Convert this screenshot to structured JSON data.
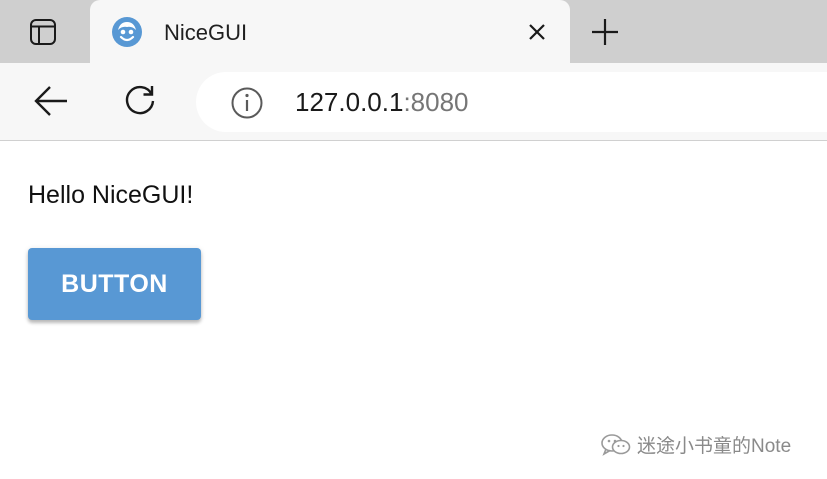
{
  "browser": {
    "tab": {
      "title": "NiceGUI"
    },
    "address": {
      "host": "127.0.0.1",
      "port": ":8080"
    }
  },
  "page": {
    "greeting": "Hello NiceGUI!",
    "button_label": "BUTTON"
  },
  "watermark": {
    "text": "迷途小书童的Note"
  },
  "colors": {
    "button": "#5898d4",
    "favicon": "#5898d4",
    "tabstrip": "#cfcfcf",
    "toolbar": "#f7f7f7"
  },
  "icons": [
    "tab-actions-icon",
    "nicegui-favicon-icon",
    "close-icon",
    "new-tab-icon",
    "back-arrow-icon",
    "reload-icon",
    "info-icon",
    "wechat-icon"
  ]
}
